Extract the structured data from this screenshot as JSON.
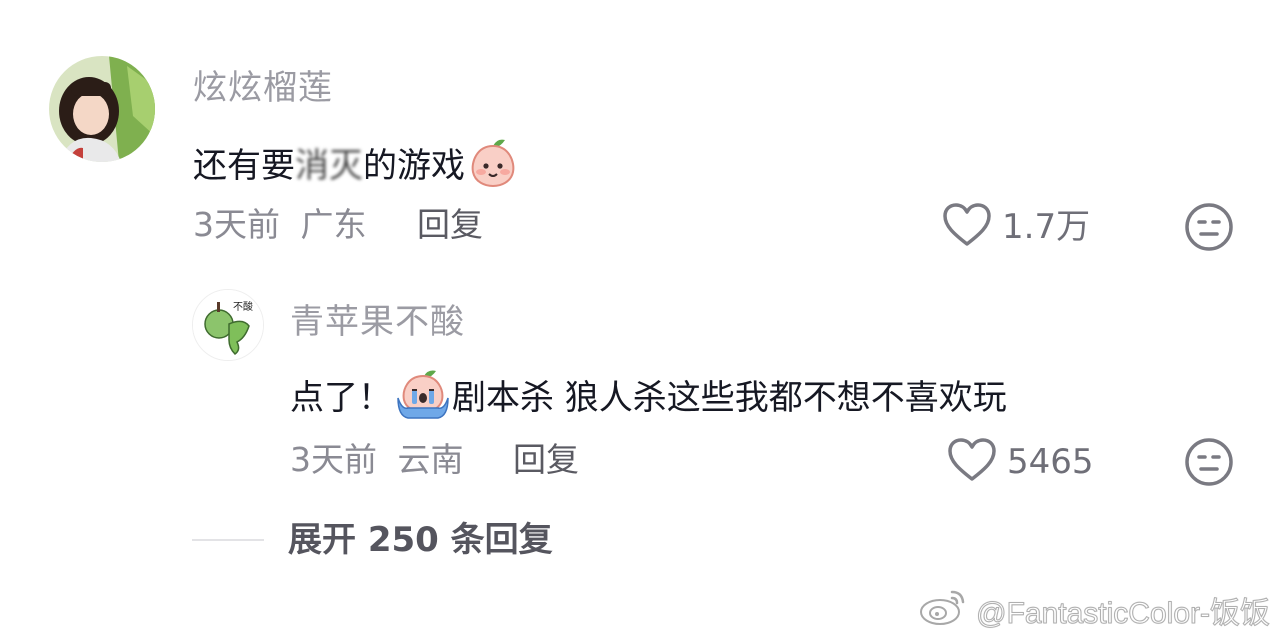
{
  "comments": [
    {
      "username": "炫炫榴莲",
      "content_before": "还有要",
      "content_blurred": "消灭",
      "content_after": "的游戏",
      "emoji": "peach-smile-emoji",
      "time": "3天前",
      "location": "广东",
      "reply_label": "回复",
      "like_count": "1.7万"
    },
    {
      "username": "青苹果不酸",
      "avatar_text": "不酸",
      "content_before": "点了！",
      "emoji": "peach-crying-emoji",
      "content_after": "剧本杀 狼人杀这些我都不想不喜欢玩",
      "time": "3天前",
      "location": "云南",
      "reply_label": "回复",
      "like_count": "5465"
    }
  ],
  "expand_replies": "展开 250 条回复",
  "watermark": "@FantasticColor-饭饭",
  "icons": {
    "like": "heart-outline-icon",
    "dislike": "neutral-face-icon",
    "watermark_logo": "weibo-logo-icon"
  },
  "colors": {
    "text_primary": "#161823",
    "text_secondary": "#8a8a93",
    "username": "#9b9ba3"
  }
}
